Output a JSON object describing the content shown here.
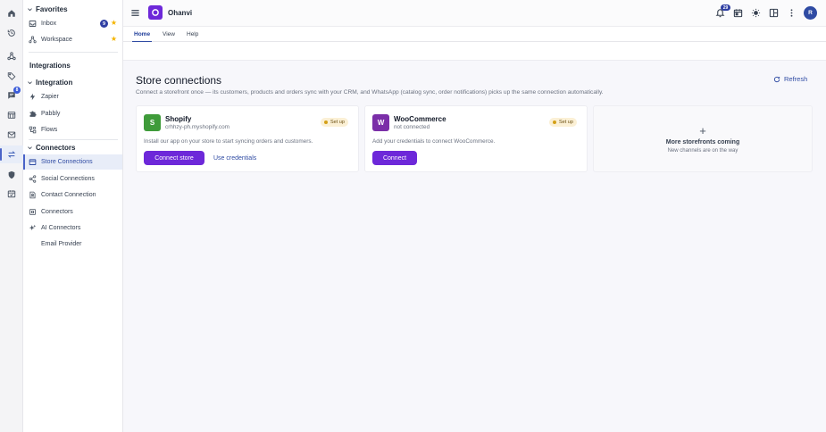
{
  "app": {
    "name": "Ohanvi",
    "logo_letter": "O",
    "accent": "#6d28d9",
    "link_color": "#2f4ba3"
  },
  "topbar": {
    "notification_count": "29",
    "avatar_initial": "R",
    "icons": [
      "menu-icon",
      "bell-icon",
      "calendar-icon",
      "theme-sun-icon",
      "layout-icon",
      "more-vertical-icon"
    ]
  },
  "rail": {
    "items": [
      "home-icon",
      "history-icon",
      "nodes-icon",
      "tag-icon",
      "chat-icon",
      "shop-icon",
      "mail-icon",
      "transfer-icon",
      "security-icon",
      "calendar-check-icon"
    ],
    "chat_badge": "8"
  },
  "sidebar": {
    "favorites": {
      "title": "Favorites",
      "items": [
        {
          "label": "Inbox",
          "badge": "9",
          "starred": true
        },
        {
          "label": "Workspace",
          "starred": true
        }
      ]
    },
    "integrations_title": "Integrations",
    "integration": {
      "title": "Integration",
      "items": [
        {
          "label": "Zapier"
        },
        {
          "label": "Pabbly"
        },
        {
          "label": "Flows"
        }
      ]
    },
    "connectors": {
      "title": "Connectors",
      "items": [
        {
          "label": "Store Connections",
          "active": true
        },
        {
          "label": "Social Connections"
        },
        {
          "label": "Contact Connection"
        },
        {
          "label": "Connectors"
        },
        {
          "label": "AI Connectors"
        },
        {
          "label": "Email Provider"
        }
      ]
    }
  },
  "ribbon": {
    "tabs": [
      "Home",
      "View",
      "Help"
    ],
    "active": "Home"
  },
  "main": {
    "title": "Store connections",
    "subtitle": "Connect a storefront once — its customers, products and orders sync with your CRM, and WhatsApp (catalog sync, order notifications) picks up the same connection automatically.",
    "refresh_label": "Refresh",
    "cards": [
      {
        "logo_letter": "S",
        "logo_color": "#3f9b3a",
        "name": "Shopify",
        "sub": "crhhzy-ph.myshopify.com",
        "status": "Set up",
        "description": "Install our app on your store to start syncing orders and customers.",
        "primary_label": "Connect store",
        "secondary_label": "Use credentials"
      },
      {
        "logo_letter": "W",
        "logo_color": "#7b2fa8",
        "name": "WooCommerce",
        "sub": "not connected",
        "status": "Set up",
        "description": "Add your credentials to connect WooCommerce.",
        "primary_label": "Connect"
      }
    ],
    "coming": {
      "plus": "+",
      "title": "More storefronts coming",
      "sub": "New channels are on the way"
    }
  }
}
